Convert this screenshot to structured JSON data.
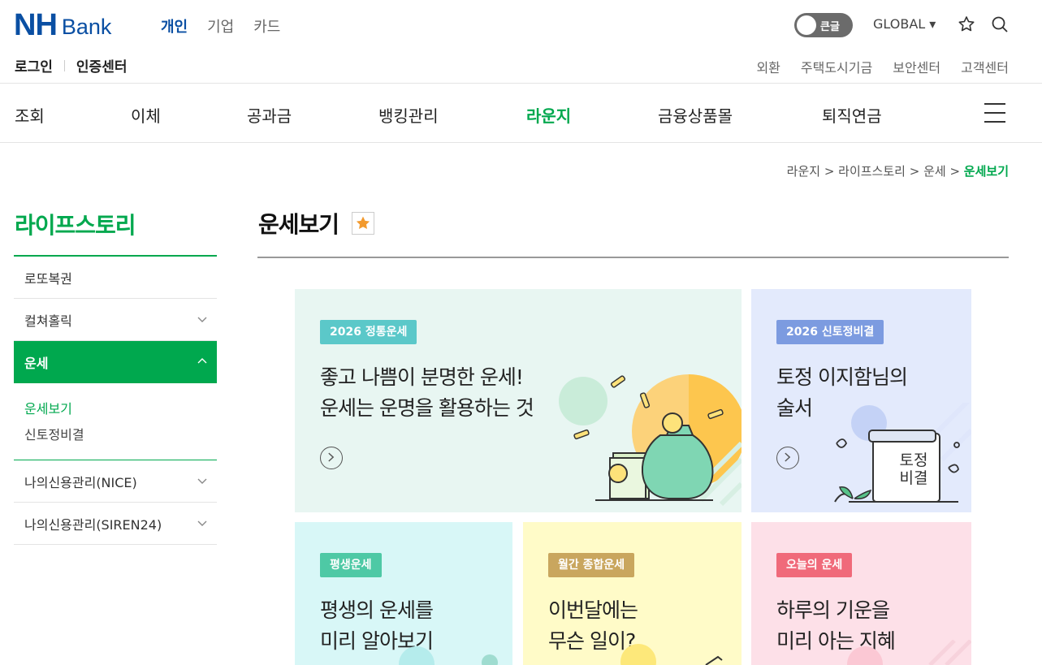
{
  "header": {
    "logo_nh": "NH",
    "logo_bank": "Bank",
    "tabs": [
      {
        "label": "개인",
        "active": true
      },
      {
        "label": "기업",
        "active": false
      },
      {
        "label": "카드",
        "active": false
      }
    ],
    "toggle_label": "큰글",
    "global_label": "GLOBAL ▾",
    "login": "로그인",
    "cert_center": "인증센터",
    "utility": [
      "외환",
      "주택도시기금",
      "보안센터",
      "고객센터"
    ]
  },
  "gnb": {
    "items": [
      "조회",
      "이체",
      "공과금",
      "뱅킹관리",
      "라운지",
      "금융상품몰",
      "퇴직연금"
    ],
    "active_index": 4,
    "accent_color": "#00a84e"
  },
  "breadcrumb": {
    "items": [
      "라운지",
      "라이프스토리",
      "운세"
    ],
    "current": "운세보기",
    "separator": " > "
  },
  "sidebar": {
    "title": "라이프스토리",
    "items": [
      {
        "label": "로또복권",
        "expandable": false
      },
      {
        "label": "컬쳐홀릭",
        "expandable": true
      },
      {
        "label": "운세",
        "expandable": true,
        "active": true
      },
      {
        "label": "나의신용관리(NICE)",
        "expandable": true
      },
      {
        "label": "나의신용관리(SIREN24)",
        "expandable": true
      }
    ],
    "sub_items": [
      {
        "label": "운세보기",
        "active": true
      },
      {
        "label": "신토정비결",
        "active": false
      }
    ]
  },
  "main": {
    "title": "운세보기",
    "cards": [
      {
        "badge": "2026 정통운세",
        "badge_color": "#5bc8c9",
        "bg": "#e8f6f2",
        "text": "좋고 나쁨이 분명한 운세!\n운세는 운명을 활용하는 것"
      },
      {
        "badge": "2026 신토정비결",
        "badge_color": "#7c9be0",
        "bg": "#e3eafc",
        "text": "토정 이지함님의\n술서",
        "book_text": "토정\n비결"
      },
      {
        "badge": "평생운세",
        "badge_color": "#4ec9a5",
        "bg": "#d8f7f7",
        "text": "평생의 운세를\n미리 알아보기"
      },
      {
        "badge": "월간 종합운세",
        "badge_color": "#c9a65e",
        "bg": "#fffbc8",
        "text": "이번달에는\n무슨 일이?"
      },
      {
        "badge": "오늘의 운세",
        "badge_color": "#f06a7a",
        "bg": "#fde0e8",
        "text": "하루의 기운을\n미리 아는 지혜"
      }
    ]
  }
}
